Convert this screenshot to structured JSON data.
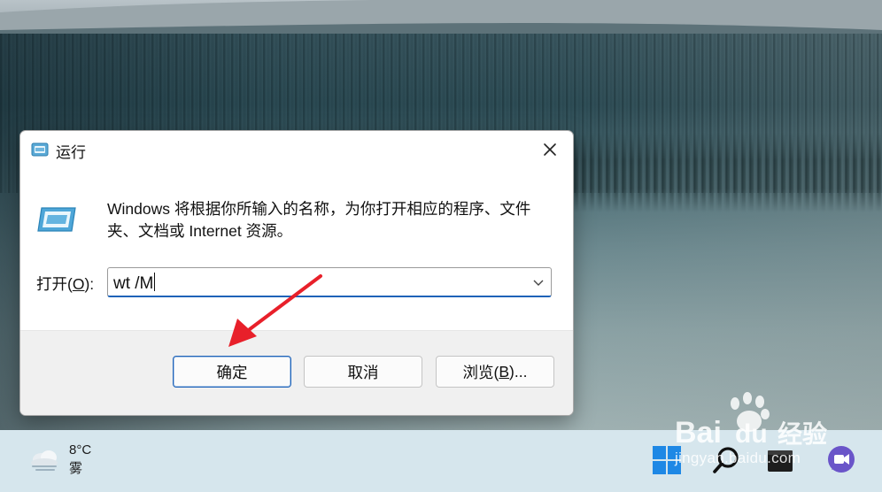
{
  "dialog": {
    "title": "运行",
    "description": "Windows 将根据你所输入的名称，为你打开相应的程序、文件夹、文档或 Internet 资源。",
    "open_label_prefix": "打开(",
    "open_label_accel": "O",
    "open_label_suffix": "):",
    "input_value": "wt /M",
    "buttons": {
      "ok": "确定",
      "cancel": "取消",
      "browse_prefix": "浏览(",
      "browse_accel": "B",
      "browse_suffix": ")..."
    },
    "accent_color": "#1f63b8"
  },
  "taskbar": {
    "weather": {
      "temperature": "8°C",
      "condition": "雾",
      "icon": "cloud-fog-icon"
    },
    "icons": [
      "windows-start-icon",
      "search-icon",
      "terminal-icon",
      "chat-icon"
    ]
  },
  "watermark": {
    "logo_text": "Bai du 经验",
    "url": "jingyan.baidu.com"
  },
  "annotation": {
    "arrow_color": "#e8202a"
  }
}
